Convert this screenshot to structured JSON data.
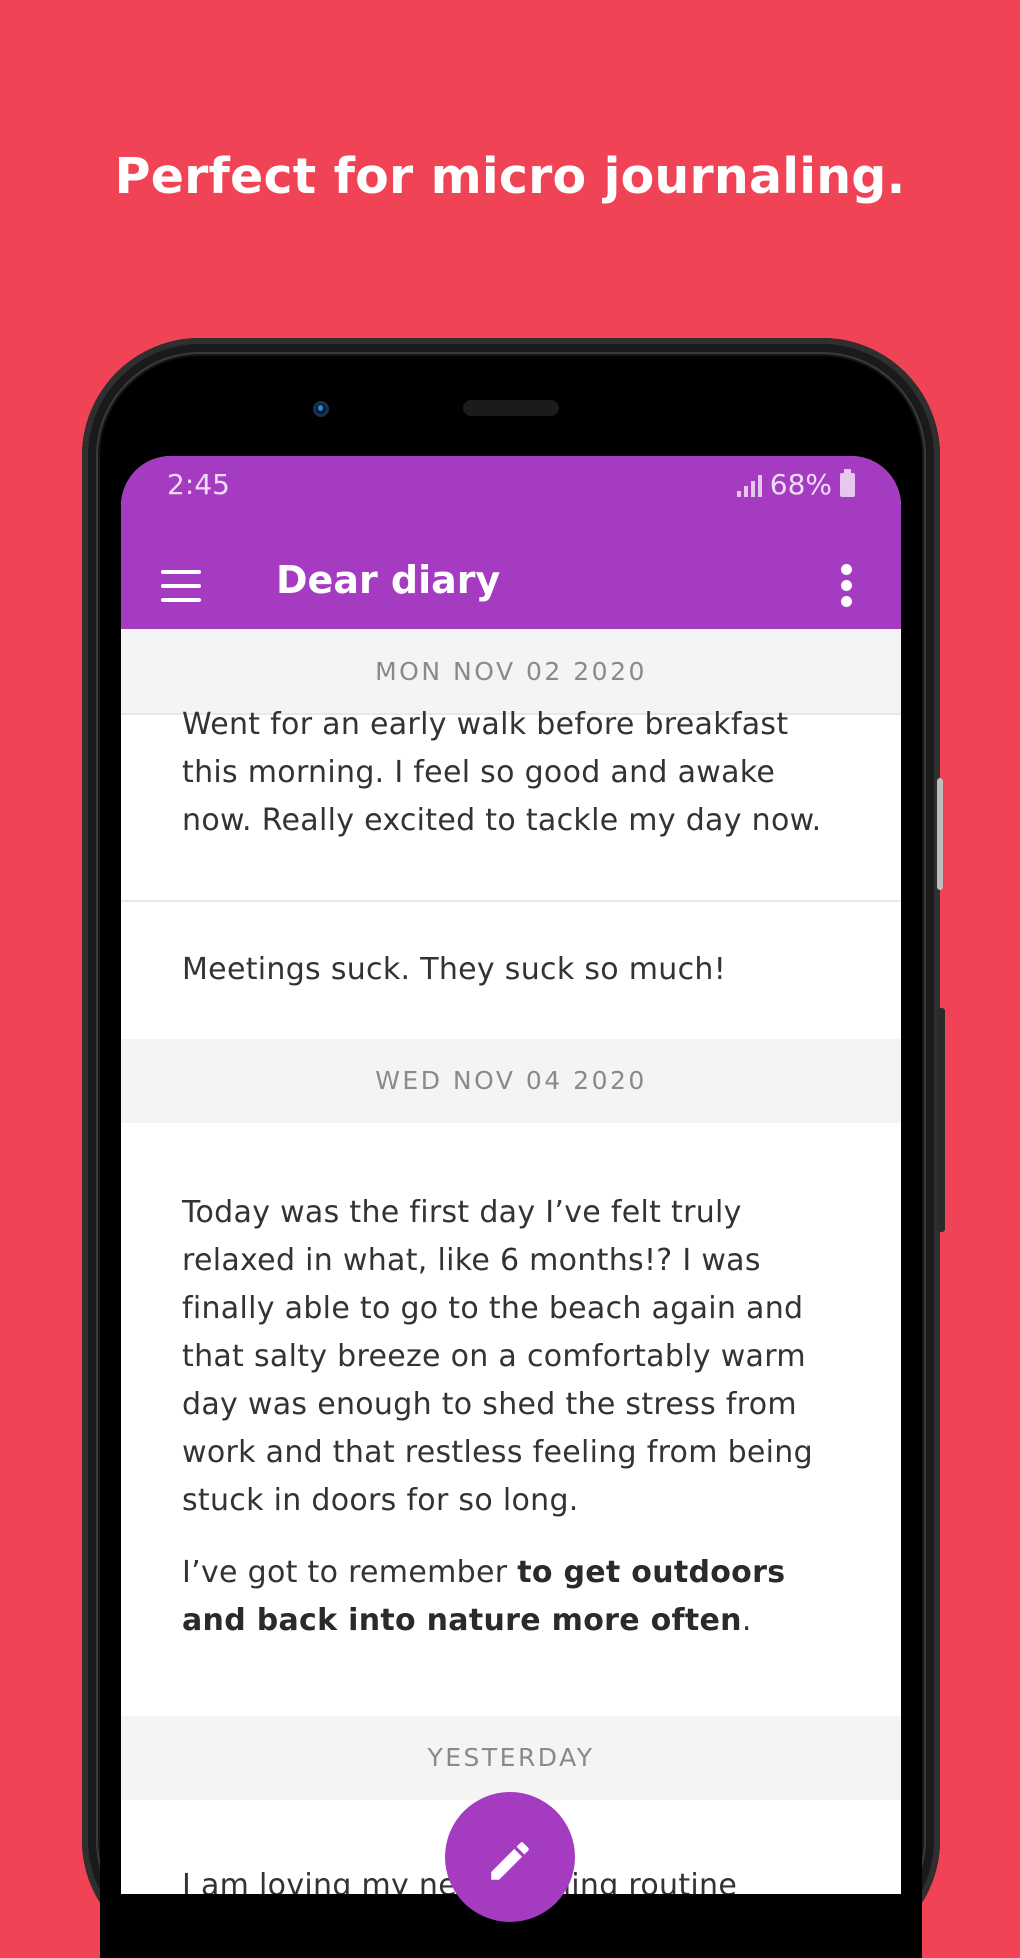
{
  "headline": "Perfect for micro journaling.",
  "status": {
    "time": "2:45",
    "battery": "68%"
  },
  "appbar": {
    "title": "Dear diary"
  },
  "sections": {
    "date1": "MON NOV 02 2020",
    "entry1": "Went for an early walk before breakfast this morning. I feel so good and awake now. Really excited to tackle my day now.",
    "entry2": "Meetings suck. They suck so much!",
    "date2": "WED NOV 04 2020",
    "entry3_p1": "Today was the first day I’ve felt truly relaxed in what, like 6 months!? I was finally able to go to the beach again and that salty breeze on a comfortably warm day was enough to shed the stress from work and that restless feeling from being stuck in doors for so long.",
    "entry3_p2_prefix": "I’ve got to remember ",
    "entry3_p2_bold": "to get outdoors and back into nature more often",
    "entry3_p2_suffix": ".",
    "date3": "YESTERDAY",
    "entry4": "I am loving my new morning routine"
  },
  "icons": {
    "menu": "menu-icon",
    "more": "more-vert-icon",
    "signal": "signal-icon",
    "battery": "battery-icon",
    "fab": "pencil-icon"
  },
  "colors": {
    "background": "#f04355",
    "accent": "#a43bc0"
  }
}
